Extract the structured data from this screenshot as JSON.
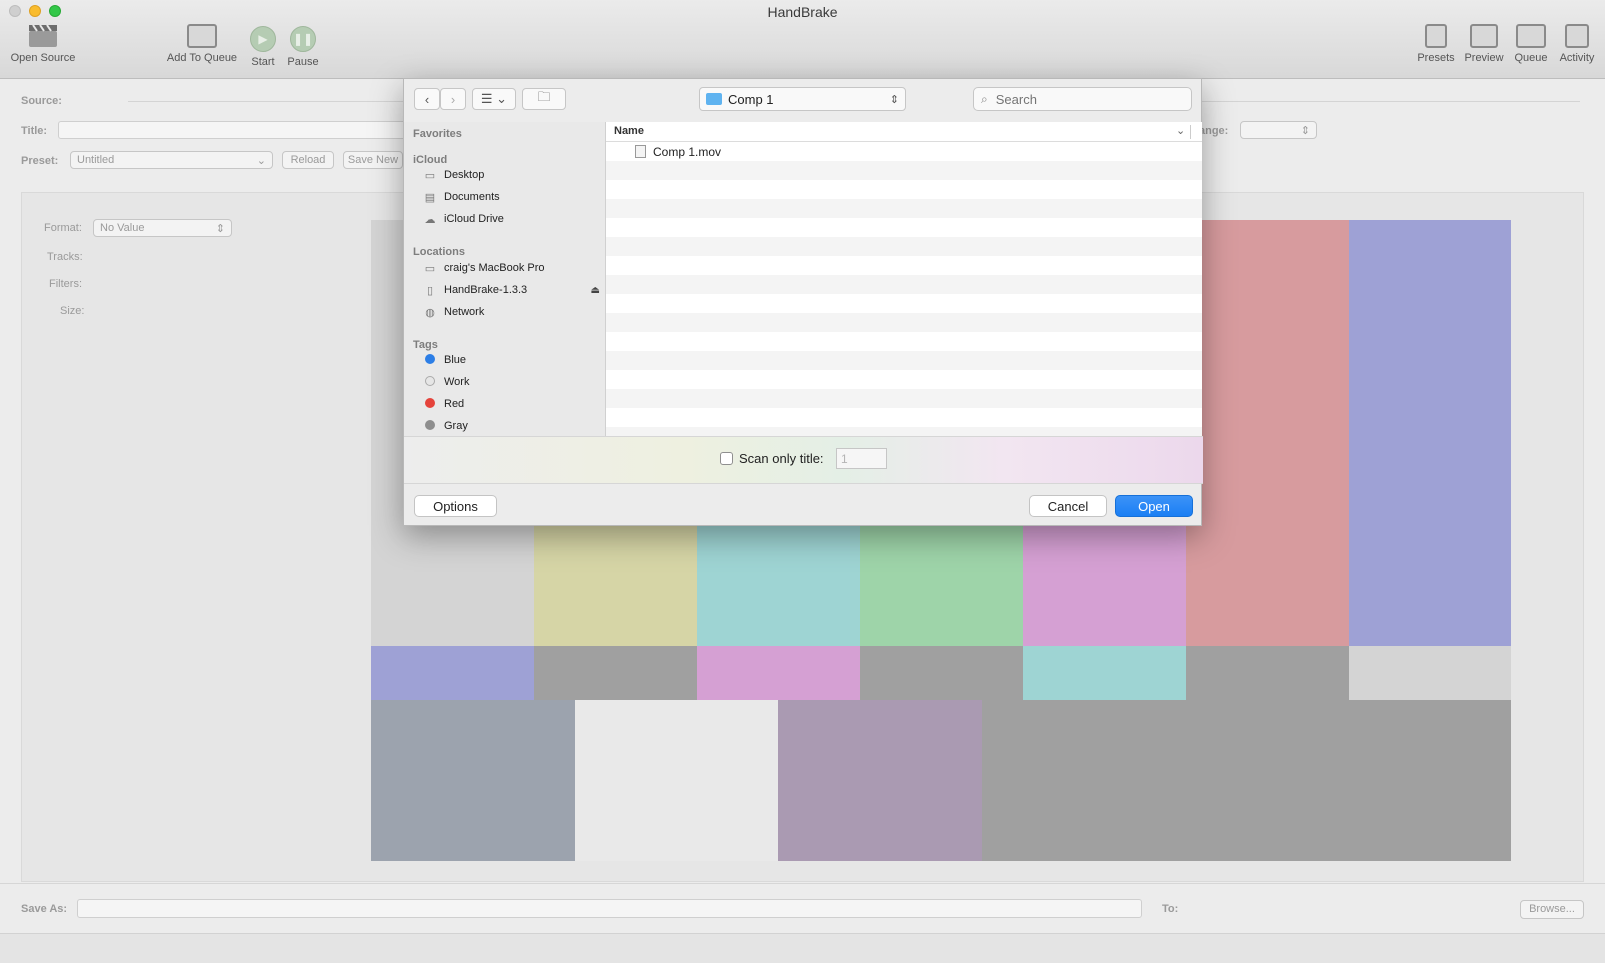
{
  "window": {
    "title": "HandBrake"
  },
  "colors": {
    "close": "#f25f58",
    "minimize": "#f9bc2e",
    "zoom": "#33c748",
    "accent": "#1b7ff4"
  },
  "toolbar": {
    "open_source": "Open Source",
    "add_to_queue": "Add To Queue",
    "start": "Start",
    "pause": "Pause",
    "presets": "Presets",
    "preview": "Preview",
    "queue": "Queue",
    "activity": "Activity"
  },
  "main": {
    "source_label": "Source:",
    "title_label": "Title:",
    "range_label": "ange:",
    "preset_label": "Preset:",
    "preset_value": "Untitled",
    "reload": "Reload",
    "save_new": "Save New",
    "format_label": "Format:",
    "format_value": "No Value",
    "tracks_label": "Tracks:",
    "filters_label": "Filters:",
    "size_label": "Size:",
    "save_as_label": "Save As:",
    "to_label": "To:",
    "browse": "Browse..."
  },
  "dialog": {
    "location": "Comp 1",
    "search_placeholder": "Search",
    "sidebar": {
      "favorites": "Favorites",
      "icloud": "iCloud",
      "icloud_items": [
        "Desktop",
        "Documents",
        "iCloud Drive"
      ],
      "locations": "Locations",
      "location_items": [
        "craig's MacBook Pro",
        "HandBrake-1.3.3",
        "Network"
      ],
      "tags": "Tags",
      "tag_items": [
        {
          "name": "Blue",
          "color": "#2c7ee6"
        },
        {
          "name": "Work",
          "color": "#d0d0d0"
        },
        {
          "name": "Red",
          "color": "#e5433b"
        },
        {
          "name": "Gray",
          "color": "#8e8e8e"
        }
      ]
    },
    "column_name": "Name",
    "files": [
      "Comp 1.mov"
    ],
    "scan_label": "Scan only title:",
    "scan_value": "1",
    "options": "Options",
    "cancel": "Cancel",
    "open": "Open"
  }
}
